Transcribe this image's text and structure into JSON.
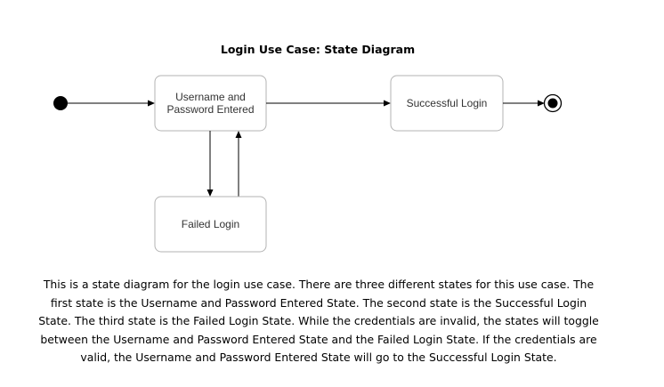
{
  "title": "Login Use Case: State Diagram",
  "states": {
    "username_password_entered": {
      "line1": "Username and",
      "line2": "Password Entered"
    },
    "successful_login": {
      "label": "Successful Login"
    },
    "failed_login": {
      "label": "Failed Login"
    }
  },
  "description": "This is a state diagram for the login use case. There are three different states for this use case. The first state is the Username and Password Entered State. The second state is the Successful Login State. The third state is the Failed Login State. While the credentials are invalid, the states will toggle between the Username and Password Entered State and the Failed Login State. If the credentials are valid, the Username and Password Entered State will go to the Successful Login State.",
  "colors": {
    "box_border": "#b3b3b3",
    "line": "#000000",
    "text": "#333333"
  }
}
